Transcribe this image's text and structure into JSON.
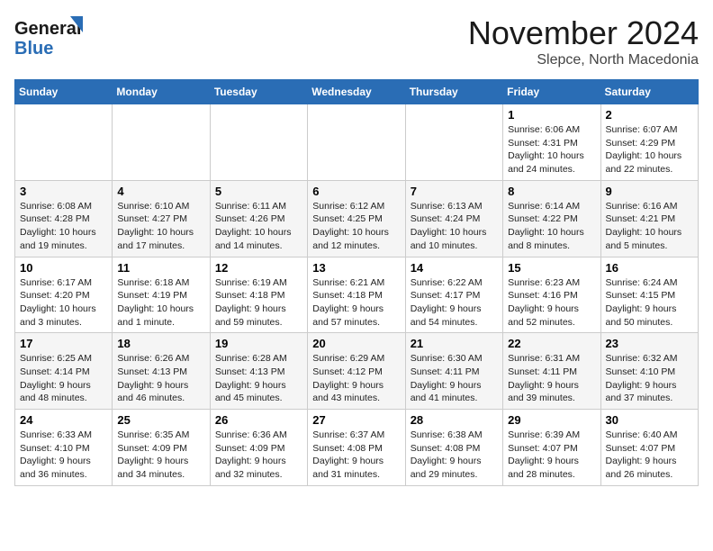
{
  "header": {
    "logo_line1": "General",
    "logo_line2": "Blue",
    "month": "November 2024",
    "location": "Slepce, North Macedonia"
  },
  "weekdays": [
    "Sunday",
    "Monday",
    "Tuesday",
    "Wednesday",
    "Thursday",
    "Friday",
    "Saturday"
  ],
  "weeks": [
    [
      {
        "day": "",
        "info": ""
      },
      {
        "day": "",
        "info": ""
      },
      {
        "day": "",
        "info": ""
      },
      {
        "day": "",
        "info": ""
      },
      {
        "day": "",
        "info": ""
      },
      {
        "day": "1",
        "info": "Sunrise: 6:06 AM\nSunset: 4:31 PM\nDaylight: 10 hours\nand 24 minutes."
      },
      {
        "day": "2",
        "info": "Sunrise: 6:07 AM\nSunset: 4:29 PM\nDaylight: 10 hours\nand 22 minutes."
      }
    ],
    [
      {
        "day": "3",
        "info": "Sunrise: 6:08 AM\nSunset: 4:28 PM\nDaylight: 10 hours\nand 19 minutes."
      },
      {
        "day": "4",
        "info": "Sunrise: 6:10 AM\nSunset: 4:27 PM\nDaylight: 10 hours\nand 17 minutes."
      },
      {
        "day": "5",
        "info": "Sunrise: 6:11 AM\nSunset: 4:26 PM\nDaylight: 10 hours\nand 14 minutes."
      },
      {
        "day": "6",
        "info": "Sunrise: 6:12 AM\nSunset: 4:25 PM\nDaylight: 10 hours\nand 12 minutes."
      },
      {
        "day": "7",
        "info": "Sunrise: 6:13 AM\nSunset: 4:24 PM\nDaylight: 10 hours\nand 10 minutes."
      },
      {
        "day": "8",
        "info": "Sunrise: 6:14 AM\nSunset: 4:22 PM\nDaylight: 10 hours\nand 8 minutes."
      },
      {
        "day": "9",
        "info": "Sunrise: 6:16 AM\nSunset: 4:21 PM\nDaylight: 10 hours\nand 5 minutes."
      }
    ],
    [
      {
        "day": "10",
        "info": "Sunrise: 6:17 AM\nSunset: 4:20 PM\nDaylight: 10 hours\nand 3 minutes."
      },
      {
        "day": "11",
        "info": "Sunrise: 6:18 AM\nSunset: 4:19 PM\nDaylight: 10 hours\nand 1 minute."
      },
      {
        "day": "12",
        "info": "Sunrise: 6:19 AM\nSunset: 4:18 PM\nDaylight: 9 hours\nand 59 minutes."
      },
      {
        "day": "13",
        "info": "Sunrise: 6:21 AM\nSunset: 4:18 PM\nDaylight: 9 hours\nand 57 minutes."
      },
      {
        "day": "14",
        "info": "Sunrise: 6:22 AM\nSunset: 4:17 PM\nDaylight: 9 hours\nand 54 minutes."
      },
      {
        "day": "15",
        "info": "Sunrise: 6:23 AM\nSunset: 4:16 PM\nDaylight: 9 hours\nand 52 minutes."
      },
      {
        "day": "16",
        "info": "Sunrise: 6:24 AM\nSunset: 4:15 PM\nDaylight: 9 hours\nand 50 minutes."
      }
    ],
    [
      {
        "day": "17",
        "info": "Sunrise: 6:25 AM\nSunset: 4:14 PM\nDaylight: 9 hours\nand 48 minutes."
      },
      {
        "day": "18",
        "info": "Sunrise: 6:26 AM\nSunset: 4:13 PM\nDaylight: 9 hours\nand 46 minutes."
      },
      {
        "day": "19",
        "info": "Sunrise: 6:28 AM\nSunset: 4:13 PM\nDaylight: 9 hours\nand 45 minutes."
      },
      {
        "day": "20",
        "info": "Sunrise: 6:29 AM\nSunset: 4:12 PM\nDaylight: 9 hours\nand 43 minutes."
      },
      {
        "day": "21",
        "info": "Sunrise: 6:30 AM\nSunset: 4:11 PM\nDaylight: 9 hours\nand 41 minutes."
      },
      {
        "day": "22",
        "info": "Sunrise: 6:31 AM\nSunset: 4:11 PM\nDaylight: 9 hours\nand 39 minutes."
      },
      {
        "day": "23",
        "info": "Sunrise: 6:32 AM\nSunset: 4:10 PM\nDaylight: 9 hours\nand 37 minutes."
      }
    ],
    [
      {
        "day": "24",
        "info": "Sunrise: 6:33 AM\nSunset: 4:10 PM\nDaylight: 9 hours\nand 36 minutes."
      },
      {
        "day": "25",
        "info": "Sunrise: 6:35 AM\nSunset: 4:09 PM\nDaylight: 9 hours\nand 34 minutes."
      },
      {
        "day": "26",
        "info": "Sunrise: 6:36 AM\nSunset: 4:09 PM\nDaylight: 9 hours\nand 32 minutes."
      },
      {
        "day": "27",
        "info": "Sunrise: 6:37 AM\nSunset: 4:08 PM\nDaylight: 9 hours\nand 31 minutes."
      },
      {
        "day": "28",
        "info": "Sunrise: 6:38 AM\nSunset: 4:08 PM\nDaylight: 9 hours\nand 29 minutes."
      },
      {
        "day": "29",
        "info": "Sunrise: 6:39 AM\nSunset: 4:07 PM\nDaylight: 9 hours\nand 28 minutes."
      },
      {
        "day": "30",
        "info": "Sunrise: 6:40 AM\nSunset: 4:07 PM\nDaylight: 9 hours\nand 26 minutes."
      }
    ]
  ]
}
